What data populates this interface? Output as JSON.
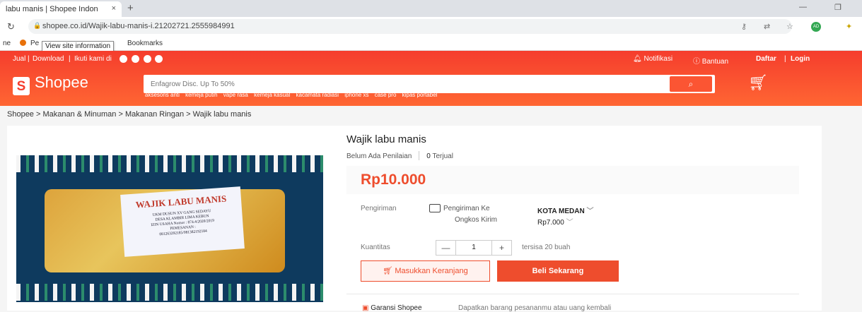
{
  "browser": {
    "tab_title": "labu manis | Shopee Indon",
    "tab_close": "×",
    "new_tab": "+",
    "url": "shopee.co.id/Wajik-labu-manis-i.21202721.2555984991",
    "bookmarks": [
      "ne",
      "Pe",
      "Bookmarks"
    ],
    "tooltip": "View site information",
    "avatar_initials": "AD",
    "minimize": "—",
    "restore": "❐"
  },
  "header": {
    "top_left": [
      "Jual",
      "Download",
      "Ikuti kami di"
    ],
    "notifications": "Notifikasi",
    "help": "Bantuan",
    "register": "Daftar",
    "login": "Login",
    "logo_text": "Shopee",
    "search_placeholder": "Enfagrow Disc. Up To 50%",
    "keywords": [
      "aksesoris anti",
      "kemeja putih",
      "vape rasa",
      "kemeja kasual",
      "kacamata radiasi",
      "iphone xs",
      "case pro",
      "kipas portabel"
    ],
    "brand_color": "#f53d2d"
  },
  "breadcrumb": "Shopee > Makanan & Minuman > Makanan Ringan > Wajik labu manis",
  "product": {
    "title": "Wajik labu manis",
    "rating_text": "Belum Ada Penilaian",
    "sold_count": "0",
    "sold_label": "Terjual",
    "price": "Rp10.000",
    "shipping_label": "Pengiriman",
    "shipping_to_label": "Pengiriman Ke",
    "shipping_to_value": "KOTA MEDAN",
    "shipping_cost_label": "Ongkos Kirim",
    "shipping_cost_value": "Rp7.000",
    "quantity_label": "Kuantitas",
    "quantity_value": "1",
    "stock_text": "tersisa 20 buah",
    "add_to_cart": "Masukkan Keranjang",
    "buy_now": "Beli Sekarang",
    "guarantee_title": "Garansi Shopee",
    "guarantee_text": "Dapatkan barang pesananmu atau uang kembali",
    "image_label_title": "WAJIK LABU MANIS",
    "image_label_lines": [
      "UKM DUSUN XV GANG SEDAYU",
      "DESA KLAMBIR LIMA KEBUN",
      "IZIN USAHA Nomor : 874.4/2020/2019",
      "PEMESANAN :",
      "081263292185/081382192184"
    ]
  }
}
